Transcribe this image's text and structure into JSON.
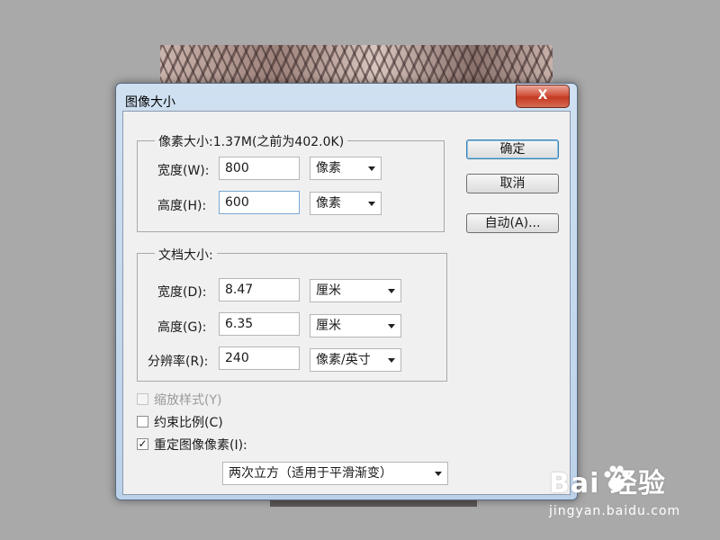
{
  "dialog": {
    "title": "图像大小",
    "close_label": "X"
  },
  "pixel_dimensions": {
    "legend": "像素大小:1.37M(之前为402.0K)",
    "width": {
      "label": "宽度(W):",
      "value": "800",
      "unit": "像素"
    },
    "height": {
      "label": "高度(H):",
      "value": "600",
      "unit": "像素"
    }
  },
  "document_size": {
    "legend": "文档大小:",
    "width": {
      "label": "宽度(D):",
      "value": "8.47",
      "unit": "厘米"
    },
    "height": {
      "label": "高度(G):",
      "value": "6.35",
      "unit": "厘米"
    },
    "resolution": {
      "label": "分辨率(R):",
      "value": "240",
      "unit": "像素/英寸"
    }
  },
  "buttons": {
    "ok": "确定",
    "cancel": "取消",
    "auto": "自动(A)..."
  },
  "options": {
    "scale_styles": {
      "label": "缩放样式(Y)",
      "checked": false,
      "disabled": true
    },
    "constrain": {
      "label": "约束比例(C)",
      "checked": false
    },
    "resample": {
      "label": "重定图像像素(I):",
      "checked": true,
      "check_mark": "✓"
    },
    "resample_method": "两次立方（适用于平滑渐变）"
  },
  "watermark": {
    "logo_text": "Bai  经验",
    "url": "jingyan.baidu.com"
  }
}
